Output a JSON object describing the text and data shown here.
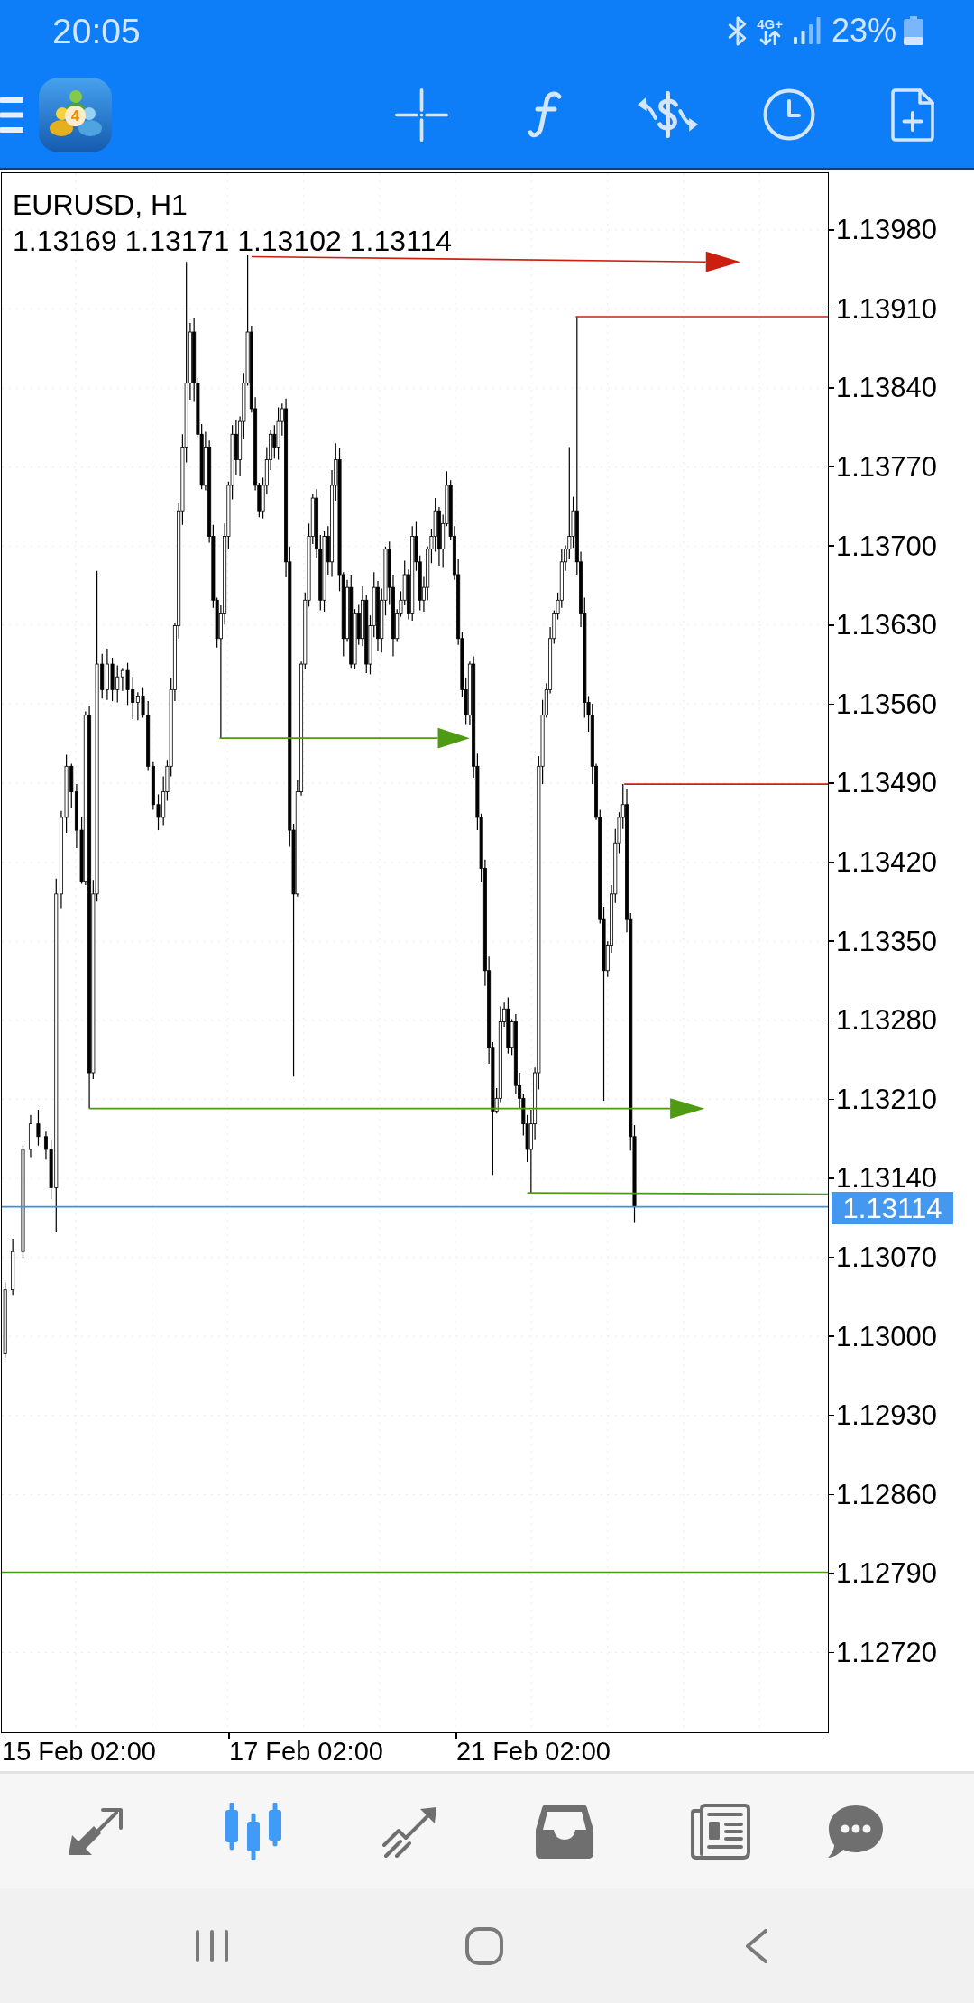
{
  "status_bar": {
    "time": "20:05",
    "network": "4G+",
    "battery": "23%"
  },
  "toolbar": {
    "logo_badge": "4"
  },
  "chart": {
    "title": "EURUSD, H1",
    "ohlc": "1.13169 1.13171 1.13102 1.13114",
    "price_axis": [
      "1.13980",
      "1.13910",
      "1.13840",
      "1.13770",
      "1.13700",
      "1.13630",
      "1.13560",
      "1.13490",
      "1.13420",
      "1.13350",
      "1.13280",
      "1.13210",
      "1.13140",
      "1.13070",
      "1.13000",
      "1.12930",
      "1.12860",
      "1.12790",
      "1.12720"
    ],
    "current_price": "1.13114",
    "time_axis": [
      "15 Feb 02:00",
      "17 Feb 02:00",
      "21 Feb 02:00"
    ]
  },
  "bottom_nav": [
    {
      "selected": false
    },
    {
      "selected": true
    },
    {
      "selected": false
    },
    {
      "selected": false
    },
    {
      "selected": false
    },
    {
      "selected": false
    }
  ]
}
